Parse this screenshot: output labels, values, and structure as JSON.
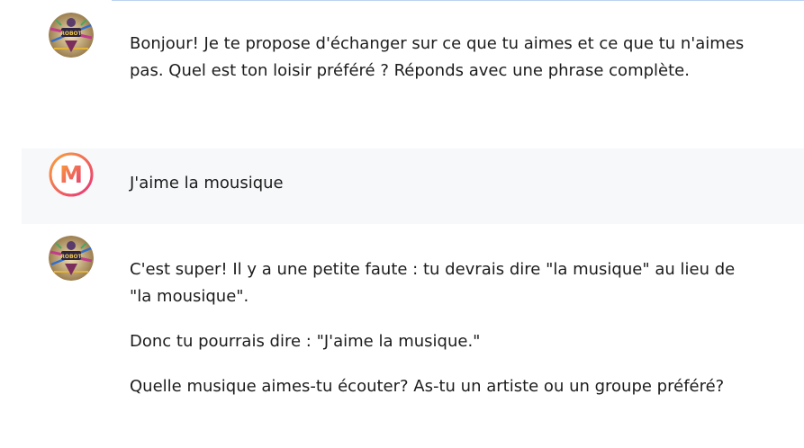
{
  "conversation": {
    "messages": [
      {
        "role": "assistant",
        "avatar_icon": "robot-character-icon",
        "paragraphs": [
          "Bonjour! Je te propose d'échanger sur ce que tu aimes et ce que tu n'aimes pas. Quel est ton loisir préféré ? Réponds avec une phrase complète."
        ]
      },
      {
        "role": "user",
        "avatar_icon": "user-m-logo-icon",
        "avatar_letter": "M",
        "paragraphs": [
          "J'aime la mousique"
        ]
      },
      {
        "role": "assistant",
        "avatar_icon": "robot-character-icon",
        "paragraphs": [
          "C'est super! Il y a une petite faute : tu devrais dire \"la musique\" au lieu de \"la mousique\".",
          "Donc tu pourrais dire : \"J'aime la musique.\"",
          "Quelle musique aimes-tu écouter? As-tu un artiste ou un groupe préféré?"
        ]
      }
    ]
  },
  "colors": {
    "user_row_background": "#f7f8fa",
    "user_logo_gradient_start": "#f9a23a",
    "user_logo_gradient_end": "#e8347a",
    "top_border": "#bcd3ee"
  }
}
